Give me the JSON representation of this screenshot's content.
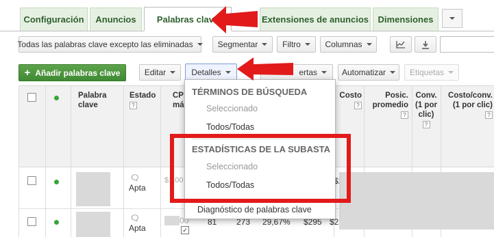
{
  "tabs": [
    {
      "label": "Configuración",
      "active": false
    },
    {
      "label": "Anuncios",
      "active": false
    },
    {
      "label": "Palabras clave",
      "active": true
    },
    {
      "label": "Extensiones de anuncios",
      "active": false
    },
    {
      "label": "Dimensiones",
      "active": false
    }
  ],
  "toolbar1": {
    "filter_scope": "Todas las palabras clave excepto las eliminadas",
    "segment": "Segmentar",
    "filter": "Filtro",
    "columns": "Columnas"
  },
  "toolbar2": {
    "add_keywords": "Añadir palabras clave",
    "edit": "Editar",
    "details": "Detalles",
    "alerts_partial": "ertas",
    "automate": "Automatizar",
    "labels": "Etiquetas"
  },
  "table": {
    "headers": {
      "keyword": "Palabra clave",
      "status": "Estado",
      "cpc_partial": "CP máx",
      "cost": "Costo",
      "avg_pos": "Posic. promedio",
      "conv": "Conv. (1 por clic)",
      "cost_conv": "Costo/conv. (1 por clic)"
    },
    "rows": [
      {
        "status": "Apta",
        "cpc_partial": "$1,00",
        "cost_partial": "$2"
      },
      {
        "status": "Apta",
        "cpc_partial": "00",
        "clicks": "81",
        "impressions": "273",
        "ctr": "29,67%",
        "cost": "$295",
        "cost_partial": "$2"
      }
    ]
  },
  "details_menu": {
    "section1_title": "TÉRMINOS DE BÚSQUEDA",
    "section1_items": [
      {
        "label": "Seleccionado",
        "disabled": true
      },
      {
        "label": "Todos/Todas",
        "disabled": false
      }
    ],
    "section2_title": "ESTADÍSTICAS DE LA SUBASTA",
    "section2_items": [
      {
        "label": "Seleccionado",
        "disabled": true
      },
      {
        "label": "Todos/Todas",
        "disabled": false
      }
    ],
    "diagnostics": "Diagnóstico de palabras clave"
  },
  "help_mark": "?",
  "colors": {
    "tab_text": "#2e5f2e",
    "add_button": "#4a9a3c",
    "highlight": "#e21a1a",
    "status_dot": "#3ba43b"
  }
}
